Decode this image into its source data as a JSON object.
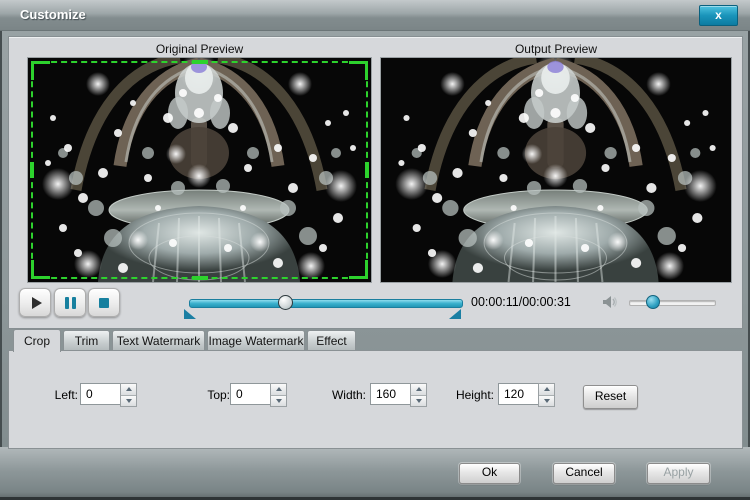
{
  "window": {
    "title": "Customize",
    "close": "x"
  },
  "previews": {
    "original_label": "Original Preview",
    "output_label": "Output Preview"
  },
  "player": {
    "time": "00:00:11/00:00:31"
  },
  "tabs": [
    {
      "label": "Crop",
      "active": true
    },
    {
      "label": "Trim",
      "active": false
    },
    {
      "label": "Text Watermark",
      "active": false
    },
    {
      "label": "Image Watermark",
      "active": false
    },
    {
      "label": "Effect",
      "active": false
    }
  ],
  "crop_panel": {
    "left_label": "Left:",
    "left_value": "0",
    "top_label": "Top:",
    "top_value": "0",
    "width_label": "Width:",
    "width_value": "160",
    "height_label": "Height:",
    "height_value": "120",
    "reset_label": "Reset"
  },
  "footer": {
    "ok": "Ok",
    "cancel": "Cancel",
    "apply": "Apply"
  },
  "colors": {
    "accent": "#2aa5c7",
    "crop_outline": "#2dd22d",
    "close_button": "#1a94ba"
  }
}
